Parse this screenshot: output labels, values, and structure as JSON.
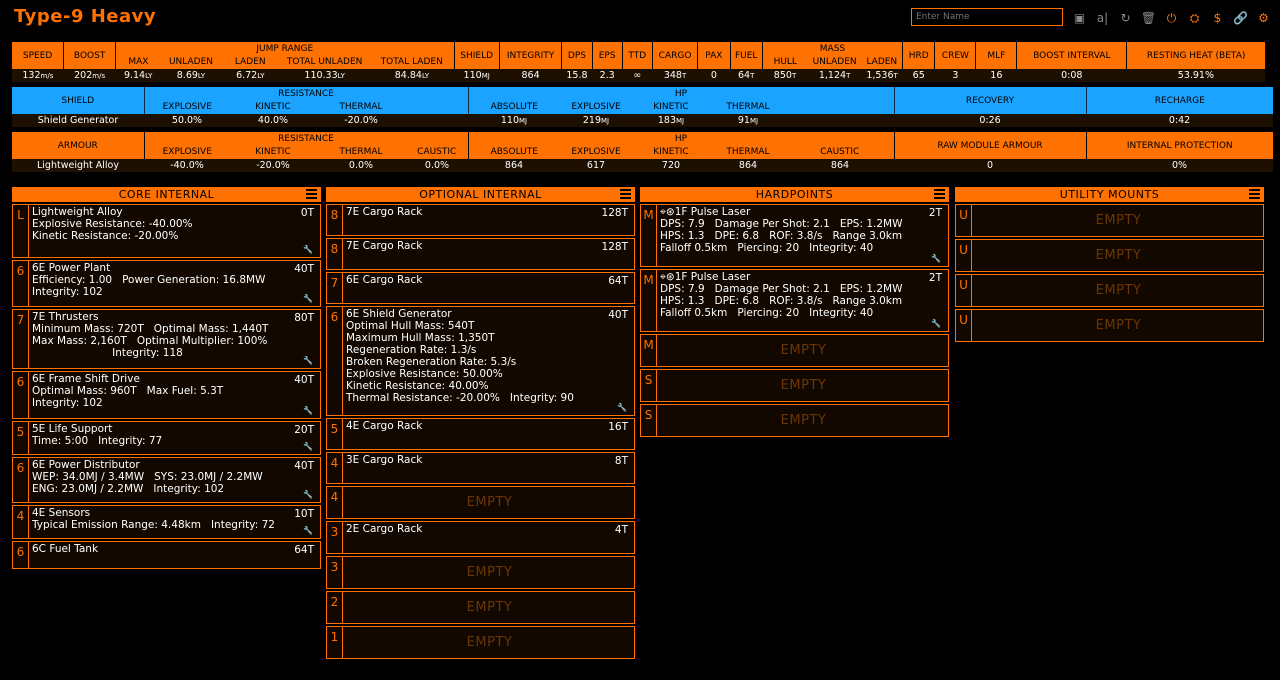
{
  "title": "Type-9 Heavy",
  "name_placeholder": "Enter Name",
  "toolbar": [
    {
      "name": "save-icon",
      "glyph": "▣"
    },
    {
      "name": "rename-icon",
      "glyph": "a|"
    },
    {
      "name": "reload-icon",
      "glyph": "↻"
    },
    {
      "name": "delete-icon",
      "glyph": "🗑"
    },
    {
      "name": "power-icon",
      "glyph": "⏻"
    },
    {
      "name": "export-icon",
      "glyph": "⛭"
    },
    {
      "name": "credits-icon",
      "glyph": "$"
    },
    {
      "name": "link-icon",
      "glyph": "🔗"
    },
    {
      "name": "settings-icon",
      "glyph": "⚙"
    }
  ],
  "stats": {
    "h_speed": "SPEED",
    "h_boost": "BOOST",
    "h_jump": "JUMP RANGE",
    "h_max": "MAX",
    "h_unladen": "UNLADEN",
    "h_laden": "LADEN",
    "h_total_unladen": "TOTAL UNLADEN",
    "h_total_laden": "TOTAL LADEN",
    "h_shield": "SHIELD",
    "h_integrity": "INTEGRITY",
    "h_dps": "DPS",
    "h_eps": "EPS",
    "h_ttd": "TTD",
    "h_cargo": "CARGO",
    "h_pax": "PAX",
    "h_fuel": "FUEL",
    "h_mass": "MASS",
    "h_hull": "HULL",
    "h_mass_unladen": "UNLADEN",
    "h_mass_laden": "LADEN",
    "h_hrd": "HRD",
    "h_crew": "CREW",
    "h_mlf": "MLF",
    "h_boost_interval": "BOOST INTERVAL",
    "h_resting_heat": "RESTING HEAT (BETA)",
    "speed": "132",
    "speed_u": "m/s",
    "boost": "202",
    "boost_u": "m/s",
    "max": "9.14",
    "max_u": "LY",
    "unladen": "8.69",
    "unladen_u": "LY",
    "laden": "6.72",
    "laden_u": "LY",
    "total_unladen": "110.33",
    "total_unladen_u": "LY",
    "total_laden": "84.84",
    "total_laden_u": "LY",
    "shield": "110",
    "shield_u": "MJ",
    "integrity": "864",
    "dps": "15.8",
    "eps": "2.3",
    "ttd": "∞",
    "cargo": "348",
    "cargo_u": "T",
    "pax": "0",
    "fuel": "64",
    "fuel_u": "T",
    "hull": "850",
    "hull_u": "T",
    "mass_unladen": "1,124",
    "mass_unladen_u": "T",
    "mass_laden": "1,536",
    "mass_laden_u": "T",
    "hrd": "65",
    "crew": "3",
    "mlf": "16",
    "boost_interval": "0:08",
    "resting_heat": "53.91%"
  },
  "shield_table": {
    "h_shield": "SHIELD",
    "h_resistance": "RESISTANCE",
    "h_explosive": "EXPLOSIVE",
    "h_kinetic": "KINETIC",
    "h_thermal": "THERMAL",
    "h_hp": "HP",
    "h_absolute": "ABSOLUTE",
    "h_hp_explosive": "EXPLOSIVE",
    "h_hp_kinetic": "KINETIC",
    "h_hp_thermal": "THERMAL",
    "h_recovery": "RECOVERY",
    "h_recharge": "RECHARGE",
    "name": "Shield Generator",
    "res_explosive": "50.0%",
    "res_kinetic": "40.0%",
    "res_thermal": "-20.0%",
    "absolute": "110",
    "absolute_u": "MJ",
    "hp_explosive": "219",
    "hp_explosive_u": "MJ",
    "hp_kinetic": "183",
    "hp_kinetic_u": "MJ",
    "hp_thermal": "91",
    "hp_thermal_u": "MJ",
    "recovery": "0:26",
    "recharge": "0:42"
  },
  "armour_table": {
    "h_armour": "ARMOUR",
    "h_resistance": "RESISTANCE",
    "h_explosive": "EXPLOSIVE",
    "h_kinetic": "KINETIC",
    "h_thermal": "THERMAL",
    "h_caustic": "CAUSTIC",
    "h_hp": "HP",
    "h_absolute": "ABSOLUTE",
    "h_hp_explosive": "EXPLOSIVE",
    "h_hp_kinetic": "KINETIC",
    "h_hp_thermal": "THERMAL",
    "h_hp_caustic": "CAUSTIC",
    "h_raw": "RAW MODULE ARMOUR",
    "h_internal": "INTERNAL PROTECTION",
    "name": "Lightweight Alloy",
    "res_explosive": "-40.0%",
    "res_kinetic": "-20.0%",
    "res_thermal": "0.0%",
    "res_caustic": "0.0%",
    "absolute": "864",
    "hp_explosive": "617",
    "hp_kinetic": "720",
    "hp_thermal": "864",
    "hp_caustic": "864",
    "raw": "0",
    "internal": "0%"
  },
  "core": {
    "title": "CORE INTERNAL",
    "slots": [
      {
        "size": "L",
        "name": "Lightweight Alloy",
        "mass": "0T",
        "lines": [
          "Explosive Resistance: -40.00%",
          "Kinetic Resistance: -20.00%"
        ]
      },
      {
        "size": "6",
        "name": "6E Power Plant",
        "mass": "40T",
        "lines": [
          "Efficiency: 1.00   Power Generation: 16.8MW",
          "Integrity: 102"
        ]
      },
      {
        "size": "7",
        "name": "7E Thrusters",
        "mass": "80T",
        "lines": [
          "Minimum Mass: 720T   Optimal Mass: 1,440T",
          "Max Mass: 2,160T   Optimal Multiplier: 100%",
          "                        Integrity: 118"
        ]
      },
      {
        "size": "6",
        "name": "6E Frame Shift Drive",
        "mass": "40T",
        "lines": [
          "Optimal Mass: 960T   Max Fuel: 5.3T",
          "Integrity: 102"
        ]
      },
      {
        "size": "5",
        "name": "5E Life Support",
        "mass": "20T",
        "lines": [
          "Time: 5:00   Integrity: 77"
        ]
      },
      {
        "size": "6",
        "name": "6E Power Distributor",
        "mass": "40T",
        "lines": [
          "WEP: 34.0MJ / 3.4MW   SYS: 23.0MJ / 2.2MW",
          "ENG: 23.0MJ / 2.2MW   Integrity: 102"
        ]
      },
      {
        "size": "4",
        "name": "4E Sensors",
        "mass": "10T",
        "lines": [
          "Typical Emission Range: 4.48km   Integrity: 72"
        ]
      },
      {
        "size": "6",
        "name": "6C Fuel Tank",
        "mass": "64T",
        "lines": []
      }
    ]
  },
  "optional": {
    "title": "OPTIONAL INTERNAL",
    "slots": [
      {
        "size": "8",
        "name": "7E Cargo Rack",
        "mass": "128T",
        "lines": []
      },
      {
        "size": "8",
        "name": "7E Cargo Rack",
        "mass": "128T",
        "lines": []
      },
      {
        "size": "7",
        "name": "6E Cargo Rack",
        "mass": "64T",
        "lines": []
      },
      {
        "size": "6",
        "name": "6E Shield Generator",
        "mass": "40T",
        "lines": [
          "Optimal Hull Mass: 540T",
          "Maximum Hull Mass: 1,350T",
          "Regeneration Rate: 1.3/s",
          "Broken Regeneration Rate: 5.3/s",
          "Explosive Resistance: 50.00%",
          "Kinetic Resistance: 40.00%",
          "Thermal Resistance: -20.00%   Integrity: 90"
        ]
      },
      {
        "size": "5",
        "name": "4E Cargo Rack",
        "mass": "16T",
        "lines": []
      },
      {
        "size": "4",
        "name": "3E Cargo Rack",
        "mass": "8T",
        "lines": []
      },
      {
        "size": "4",
        "empty": "EMPTY"
      },
      {
        "size": "3",
        "name": "2E Cargo Rack",
        "mass": "4T",
        "lines": []
      },
      {
        "size": "3",
        "empty": "EMPTY"
      },
      {
        "size": "2",
        "empty": "EMPTY"
      },
      {
        "size": "1",
        "empty": "EMPTY"
      }
    ]
  },
  "hardpoints": {
    "title": "HARDPOINTS",
    "slots": [
      {
        "size": "M",
        "name": "1F Pulse Laser",
        "mass": "2T",
        "lines": [
          "DPS: 7.9   Damage Per Shot: 2.1   EPS: 1.2MW",
          "HPS: 1.3   DPE: 6.8   ROF: 3.8/s   Range 3.0km",
          "Falloff 0.5km   Piercing: 20   Integrity: 40"
        ]
      },
      {
        "size": "M",
        "name": "1F Pulse Laser",
        "mass": "2T",
        "lines": [
          "DPS: 7.9   Damage Per Shot: 2.1   EPS: 1.2MW",
          "HPS: 1.3   DPE: 6.8   ROF: 3.8/s   Range 3.0km",
          "Falloff 0.5km   Piercing: 20   Integrity: 40"
        ]
      },
      {
        "size": "M",
        "empty": "EMPTY"
      },
      {
        "size": "S",
        "empty": "EMPTY"
      },
      {
        "size": "S",
        "empty": "EMPTY"
      }
    ]
  },
  "utility": {
    "title": "UTILITY MOUNTS",
    "slots": [
      {
        "size": "U",
        "empty": "EMPTY"
      },
      {
        "size": "U",
        "empty": "EMPTY"
      },
      {
        "size": "U",
        "empty": "EMPTY"
      },
      {
        "size": "U",
        "empty": "EMPTY"
      }
    ]
  }
}
